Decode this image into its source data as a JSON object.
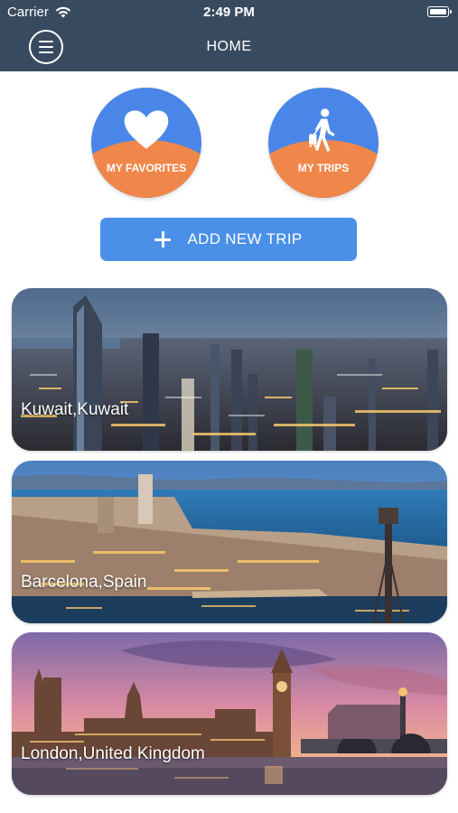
{
  "status_bar": {
    "carrier": "Carrier",
    "time": "2:49 PM"
  },
  "nav": {
    "title": "HOME"
  },
  "quick_actions": [
    {
      "label": "MY FAVORITES",
      "icon": "heart-icon"
    },
    {
      "label": "MY TRIPS",
      "icon": "traveler-icon"
    }
  ],
  "add_trip": {
    "label": "ADD NEW TRIP",
    "icon": "plus-icon"
  },
  "trips": [
    {
      "title": "Kuwait,Kuwait"
    },
    {
      "title": "Barcelona,Spain"
    },
    {
      "title": "London,United Kingdom"
    }
  ],
  "colors": {
    "nav_bg": "#384a5f",
    "accent_blue": "#4a8fe8",
    "accent_orange": "#f0874a"
  }
}
